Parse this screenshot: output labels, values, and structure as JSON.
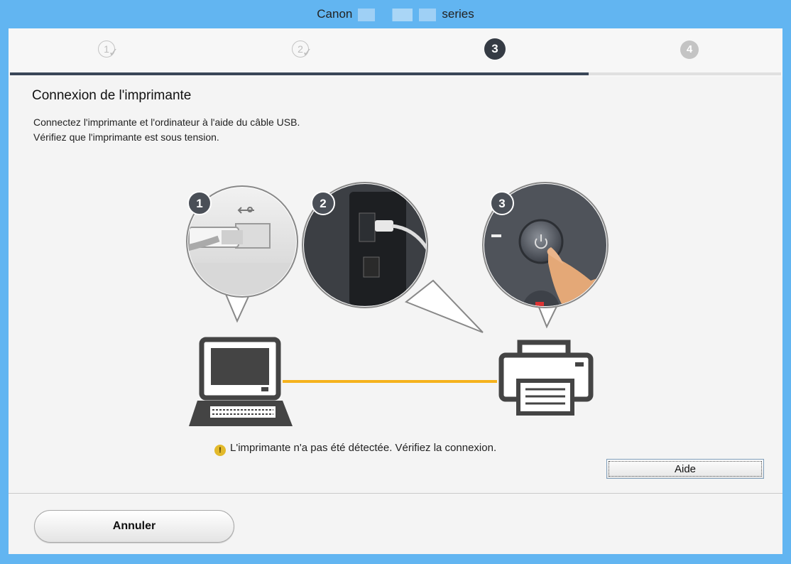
{
  "window": {
    "title_prefix": "Canon",
    "title_suffix": "series"
  },
  "steps": [
    {
      "label": "1",
      "state": "done"
    },
    {
      "label": "2",
      "state": "done"
    },
    {
      "label": "3",
      "state": "current"
    },
    {
      "label": "4",
      "state": "future"
    }
  ],
  "progress": 0.75,
  "content": {
    "heading": "Connexion de l'imprimante",
    "line1": "Connectez l'imprimante et l'ordinateur à l'aide du câble USB.",
    "line2": "Vérifiez que l'imprimante est sous tension."
  },
  "illustration": {
    "callouts": [
      "1",
      "2",
      "3"
    ]
  },
  "status": {
    "icon": "warning-icon",
    "message": "L'imprimante n'a pas été détectée. Vérifiez la connexion."
  },
  "buttons": {
    "help": "Aide",
    "cancel": "Annuler"
  },
  "colors": {
    "titlebar": "#62b5f1",
    "cable": "#f5b21d",
    "progress": "#3a4758"
  }
}
